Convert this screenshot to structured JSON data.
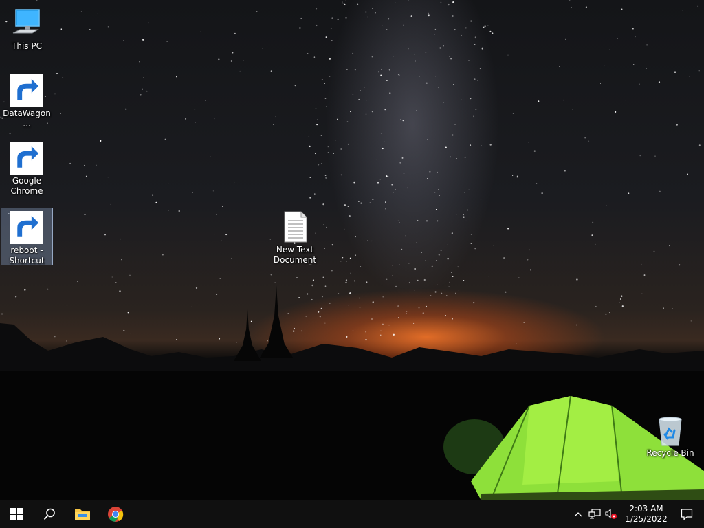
{
  "desktop": {
    "icons": [
      {
        "label": "This PC"
      },
      {
        "label": "DataWagon..."
      },
      {
        "label": "Google Chrome"
      },
      {
        "label": "reboot - Shortcut"
      },
      {
        "label": "New Text Document"
      },
      {
        "label": "Recycle Bin"
      }
    ]
  },
  "taskbar": {
    "clock_time": "2:03 AM",
    "clock_date": "1/25/2022"
  },
  "colors": {
    "taskbar_bg": "#101010",
    "windows_blue": "#ffffff",
    "explorer_yellow": "#f6c443",
    "chrome_red": "#db4437",
    "chrome_yellow": "#f4c20d",
    "chrome_green": "#0f9d58",
    "chrome_blue": "#4285f4",
    "tent_green": "#8ee03a"
  }
}
